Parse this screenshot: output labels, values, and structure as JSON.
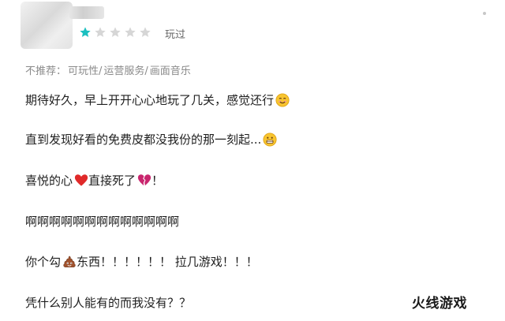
{
  "review": {
    "user": {
      "name": "",
      "avatar_icon": "avatar-icon"
    },
    "rating": {
      "value": 1,
      "max": 5,
      "filled_color": "#1bbfbf",
      "empty_color": "#d6d6d6"
    },
    "status": "玩过",
    "tags": {
      "prefix": "不推荐：",
      "items": [
        "可玩性/",
        "运营服务/",
        "画面音乐"
      ]
    },
    "lines": [
      {
        "text": "期待好久，早上开开心心地玩了几关，感觉还行",
        "emoji": "smiling-face-icon"
      },
      {
        "text": "直到发现好看的免费皮都没我份的那一刻起...",
        "emoji": "grimacing-face-icon"
      },
      {
        "parts": [
          "喜悦的心",
          " 直接死了",
          "！"
        ],
        "emojis": [
          "red-heart-icon",
          "broken-heart-icon"
        ]
      },
      {
        "text": "啊啊啊啊啊啊啊啊啊啊啊啊啊"
      },
      {
        "parts": [
          "你个勾",
          "东西！！！！！！ 拉几游戏！！！"
        ],
        "emojis": [
          "poop-icon"
        ]
      },
      {
        "text": "凭什么别人能有的而我没有？？"
      }
    ]
  },
  "watermark": "火线游戏"
}
